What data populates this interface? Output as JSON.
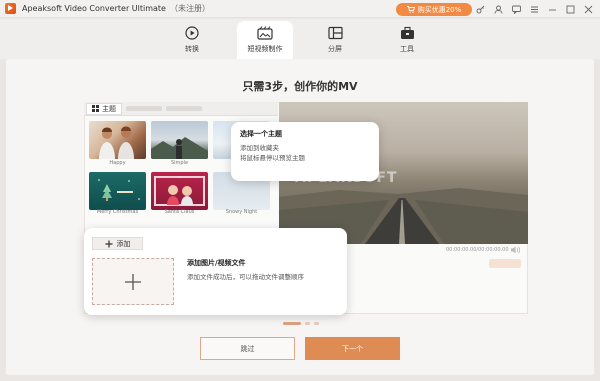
{
  "titlebar": {
    "app_name": "Apeaksoft Video Converter Ultimate",
    "registration": "（未注册）",
    "promo": "购买优惠20%"
  },
  "tabs": [
    {
      "label": "转换",
      "icon": "convert-icon"
    },
    {
      "label": "短视频制作",
      "icon": "mv-icon"
    },
    {
      "label": "分屏",
      "icon": "split-screen-icon"
    },
    {
      "label": "工具",
      "icon": "toolbox-icon"
    }
  ],
  "active_tab": "短视频制作",
  "heading": "只需3步，创作你的MV",
  "theme_panel": {
    "tab_label": "主题",
    "thumbs": [
      {
        "name": "Happy"
      },
      {
        "name": "Simple"
      },
      {
        "name": ""
      },
      {
        "name": "Merry Christmas"
      },
      {
        "name": "Santa Claus"
      },
      {
        "name": "Snowy Night"
      }
    ]
  },
  "theme_tip": {
    "title": "选择一个主题",
    "line1": "添加到收藏夹",
    "line2": "将鼠标悬停以预览主题"
  },
  "preview": {
    "watermark": "APEAKSOFT",
    "timecode": "00:00:00.00/00:00:00.00"
  },
  "add_media": {
    "button_label": "添加",
    "title": "添加图片/视频文件",
    "description": "添加文件成功后，可以拖动文件调整顺序"
  },
  "actions": {
    "skip": "跳过",
    "next": "下一个"
  },
  "colors": {
    "accent": "#df8b54",
    "promo": "#f28a43"
  }
}
